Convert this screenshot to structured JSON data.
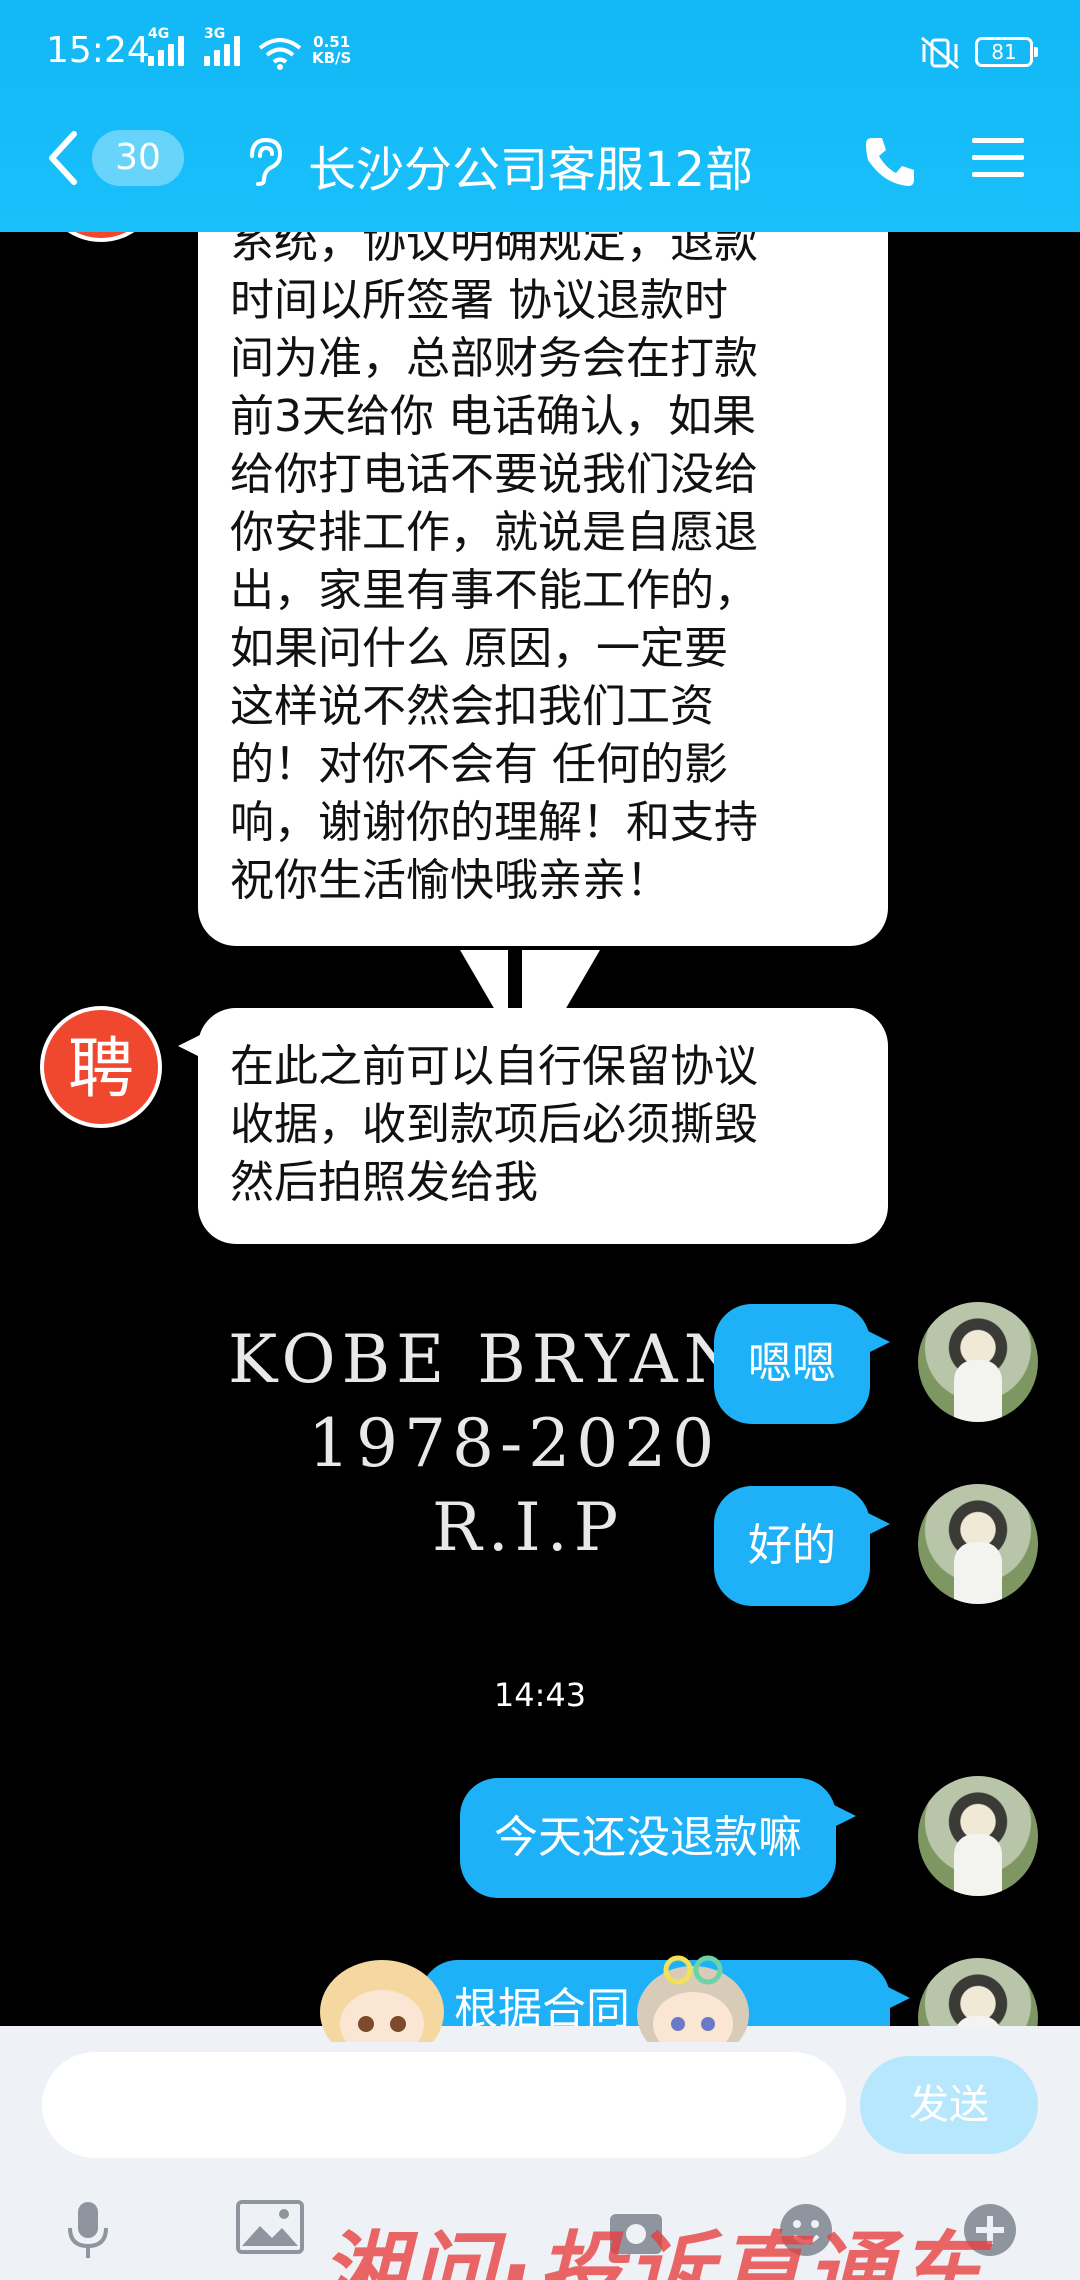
{
  "status_bar": {
    "time": "15:24",
    "network_1": "4G",
    "network_2": "3G",
    "speed_value": "0.51",
    "speed_unit": "KB/S",
    "battery": "81"
  },
  "header": {
    "unread_count": "30",
    "title": "长沙分公司客服12部"
  },
  "messages": {
    "msg1_lines": [
      "系统，协议明确规定，退款",
      "时间以所签署 协议退款时",
      "间为准，总部财务会在打款",
      "前3天给你 电话确认，如果",
      "给你打电话不要说我们没给",
      "你安排工作，就说是自愿退",
      "出，家里有事不能工作的，",
      "如果问什么 原因，一定要",
      "这样说不然会扣我们工资",
      "的！对你不会有 任何的影",
      "响，谢谢你的理解！和支持",
      "祝你生活愉快哦亲亲！"
    ],
    "msg2_lines": [
      "在此之前可以自行保留协议",
      "收据，收到款项后必须撕毁",
      "然后拍照发给我"
    ],
    "reply1": "嗯嗯",
    "reply2": "好的",
    "timestamp": "14:43",
    "reply3": "今天还没退款嘛",
    "reply4_partial": "根据合同 退款"
  },
  "avatar": {
    "zhaopin_char": "聘"
  },
  "wallpaper": {
    "line1": "KOBE BRYAN",
    "line2": "1978-2020",
    "line3": "R.I.P"
  },
  "input": {
    "placeholder": "",
    "send_label": "发送"
  },
  "watermark": {
    "text": "湘问·投诉直通车"
  },
  "colors": {
    "header": "#12b7f5",
    "bubble_out": "#1fb1f7",
    "send_button": "#b6e7fd",
    "avatar_badge": "#f0472f",
    "watermark": "#e83c3c"
  }
}
